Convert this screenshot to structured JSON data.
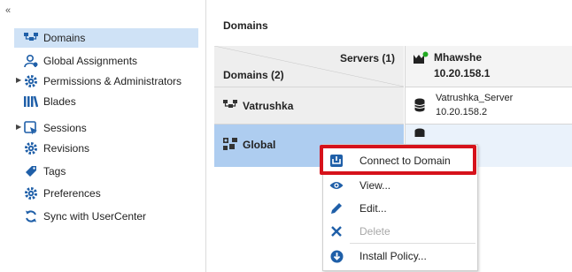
{
  "app": {
    "collapse_glyph": "«"
  },
  "sidebar": {
    "items": [
      {
        "label": "Domains",
        "icon": "domains-icon",
        "selected": true,
        "expandable": false
      },
      {
        "label": "Global Assignments",
        "icon": "global-assignments-icon",
        "selected": false,
        "expandable": false
      },
      {
        "label": "Permissions & Administrators",
        "icon": "gear-icon",
        "selected": false,
        "expandable": true
      },
      {
        "label": "Blades",
        "icon": "blades-icon",
        "selected": false,
        "expandable": false
      },
      {
        "label": "Sessions",
        "icon": "sessions-icon",
        "selected": false,
        "expandable": true
      },
      {
        "label": "Revisions",
        "icon": "gear-icon",
        "selected": false,
        "expandable": false
      },
      {
        "label": "Tags",
        "icon": "tag-icon",
        "selected": false,
        "expandable": false
      },
      {
        "label": "Preferences",
        "icon": "gear-icon",
        "selected": false,
        "expandable": false
      },
      {
        "label": "Sync with UserCenter",
        "icon": "sync-icon",
        "selected": false,
        "expandable": false
      }
    ]
  },
  "main": {
    "title": "Domains",
    "grid": {
      "servers_header": "Servers (1)",
      "domains_header": "Domains (2)",
      "mds": {
        "name": "Mhawshe",
        "ip": "10.20.158.1",
        "status": "online"
      },
      "rows": [
        {
          "domain": "Vatrushka",
          "server_name": "Vatrushka_Server",
          "server_ip": "10.20.158.2"
        },
        {
          "domain": "Global",
          "server_name": "",
          "server_ip": ""
        }
      ]
    }
  },
  "context_menu": {
    "items": [
      {
        "label": "Connect to Domain",
        "icon": "connect-icon",
        "enabled": true,
        "highlighted": true
      },
      {
        "label": "View...",
        "icon": "eye-icon",
        "enabled": true
      },
      {
        "label": "Edit...",
        "icon": "pencil-icon",
        "enabled": true
      },
      {
        "label": "Delete",
        "icon": "delete-x-icon",
        "enabled": false
      },
      {
        "label": "Install Policy...",
        "icon": "install-policy-icon",
        "enabled": true
      }
    ]
  },
  "colors": {
    "selection": "#cfe2f6",
    "row_selected": "#aecdf0",
    "highlight_border": "#d6121b",
    "icon_blue": "#1f5fa8",
    "status_green": "#22aa22"
  }
}
